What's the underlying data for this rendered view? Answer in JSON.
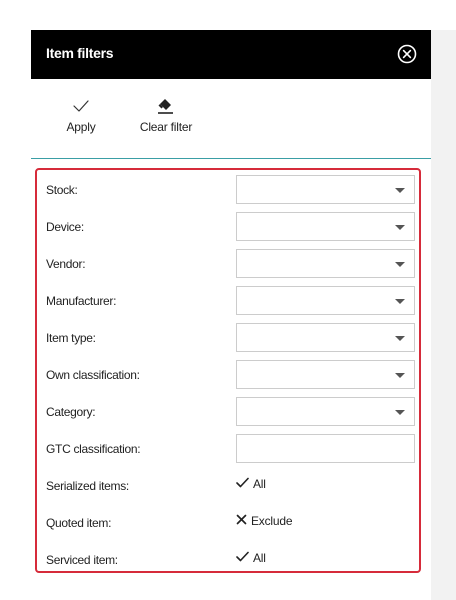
{
  "header": {
    "title": "Item filters",
    "close_icon": "close-circle-icon"
  },
  "toolbar": {
    "apply_label": "Apply",
    "apply_icon": "checkmark-icon",
    "clear_label": "Clear filter",
    "clear_icon": "eraser-icon"
  },
  "colors": {
    "header_bg": "#000000",
    "divider": "#3a9ea5",
    "highlight_border": "#d62b3a"
  },
  "filters": {
    "stock": {
      "label": "Stock:",
      "value": ""
    },
    "device": {
      "label": "Device:",
      "value": ""
    },
    "vendor": {
      "label": "Vendor:",
      "value": ""
    },
    "manufacturer": {
      "label": "Manufacturer:",
      "value": ""
    },
    "item_type": {
      "label": "Item type:",
      "value": ""
    },
    "own_classification": {
      "label": "Own classification:",
      "value": ""
    },
    "category": {
      "label": "Category:",
      "value": ""
    },
    "gtc_classification": {
      "label": "GTC classification:",
      "value": ""
    },
    "serialized_items": {
      "label": "Serialized items:",
      "value": "All",
      "icon": "checkmark-icon"
    },
    "quoted_item": {
      "label": "Quoted item:",
      "value": "Exclude",
      "icon": "x-icon"
    },
    "serviced_item": {
      "label": "Serviced item:",
      "value": "All",
      "icon": "checkmark-icon"
    }
  }
}
